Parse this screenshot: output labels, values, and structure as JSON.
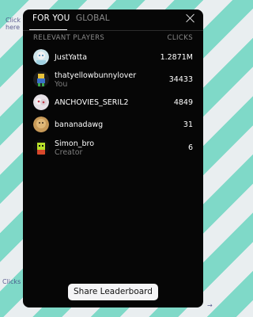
{
  "tabs": [
    {
      "label": "FOR YOU",
      "active": true
    },
    {
      "label": "GLOBAL",
      "active": false
    }
  ],
  "header": {
    "left": "RELEVANT PLAYERS",
    "right": "CLICKS"
  },
  "players": [
    {
      "name": "JustYatta",
      "sub": "",
      "score": "1.2871M",
      "avatar": "avatar-icon"
    },
    {
      "name": "thatyellowbunnylover",
      "sub": "You",
      "score": "34433",
      "avatar": "avatar-icon"
    },
    {
      "name": "ANCHOVIES_SERIL2",
      "sub": "",
      "score": "4849",
      "avatar": "avatar-icon"
    },
    {
      "name": "bananadawg",
      "sub": "",
      "score": "31",
      "avatar": "avatar-icon"
    },
    {
      "name": "Simon_bro",
      "sub": "Creator",
      "score": "6",
      "avatar": "avatar-icon"
    }
  ],
  "share_label": "Share Leaderboard",
  "background_scribbles": [
    "Click\nhere",
    "Clicks",
    "→"
  ],
  "colors": {
    "panel": "#060606",
    "accent_bg": "#7fd9c8",
    "muted": "#8a8a8a"
  }
}
